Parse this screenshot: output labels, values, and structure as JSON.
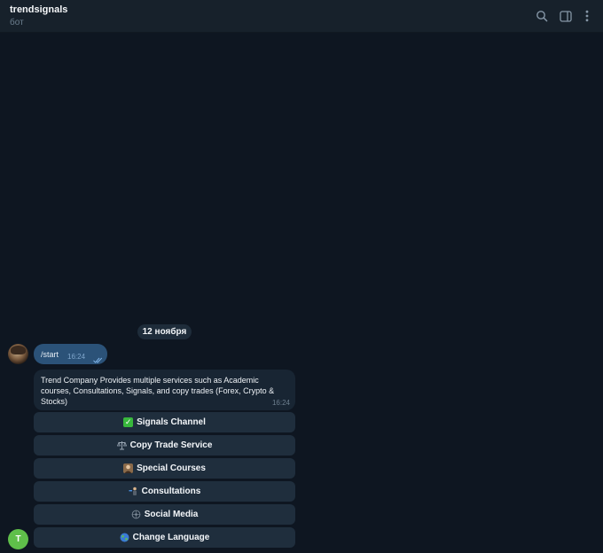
{
  "header": {
    "title": "trendsignals",
    "status": "бот",
    "icons": [
      "search-icon",
      "sidebar-toggle-icon",
      "more-vertical-icon"
    ]
  },
  "chat": {
    "date_label": "12 ноября",
    "outgoing": {
      "text": "/start",
      "time": "16:24",
      "read": true
    },
    "incoming": {
      "text": "Trend Company Provides multiple services such as Academic courses, Consultations, Signals, and copy trades (Forex, Crypto & Stocks)",
      "time": "16:24"
    },
    "keyboard": [
      {
        "label": "Signals Channel",
        "icon": "check-mark-emoji"
      },
      {
        "label": "Copy Trade Service",
        "icon": "scales-emoji"
      },
      {
        "label": "Special Courses",
        "icon": "portrait-emoji"
      },
      {
        "label": "Consultations",
        "icon": "consultant-emoji"
      },
      {
        "label": "Social Media",
        "icon": "network-emoji"
      },
      {
        "label": "Change Language",
        "icon": "globe-emoji"
      }
    ],
    "bot_avatar_letter": "T"
  },
  "colors": {
    "background": "#0e1621",
    "header": "#17212b",
    "outgoing_bubble": "#2b5278",
    "incoming_bubble": "#182533",
    "keyboard_button": "#1f2e3d",
    "bot_avatar": "#5fbf4a"
  }
}
